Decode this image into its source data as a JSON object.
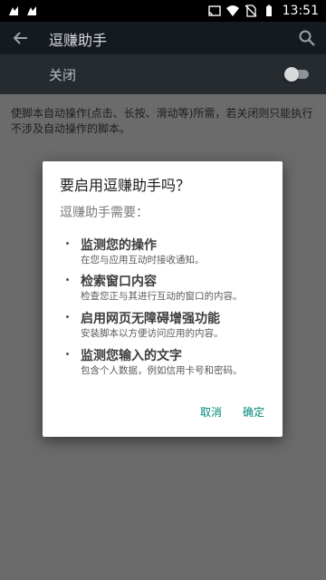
{
  "status_bar": {
    "time": "13:51",
    "icons": [
      "notification-icon",
      "notification-icon",
      "cast-icon",
      "wifi-icon",
      "no-sim-icon",
      "battery-icon"
    ]
  },
  "app_bar": {
    "title": "逗赚助手",
    "icons": [
      "back-arrow-icon",
      "search-icon"
    ]
  },
  "switch_bar": {
    "label": "关闭",
    "toggle_state": "off"
  },
  "description": "使脚本自动操作(点击、长按、滑动等)所需，若关闭则只能执行不涉及自动操作的脚本。",
  "dialog": {
    "title": "要启用逗赚助手吗？",
    "subtitle": "逗赚助手需要：",
    "permissions": [
      {
        "title": "监测您的操作",
        "desc": "在您与应用互动时接收通知。"
      },
      {
        "title": "检索窗口内容",
        "desc": "检查您正与其进行互动的窗口的内容。"
      },
      {
        "title": "启用网页无障碍增强功能",
        "desc": "安装脚本以方便访问应用的内容。"
      },
      {
        "title": "监测您输入的文字",
        "desc": "包含个人数据，例如信用卡号和密码。"
      }
    ],
    "cancel_label": "取消",
    "ok_label": "确定"
  },
  "colors": {
    "accent": "#00897b",
    "app_bar": "#141a20",
    "switch_bar": "#262b30",
    "scrim_background": "#6b6b6b"
  }
}
